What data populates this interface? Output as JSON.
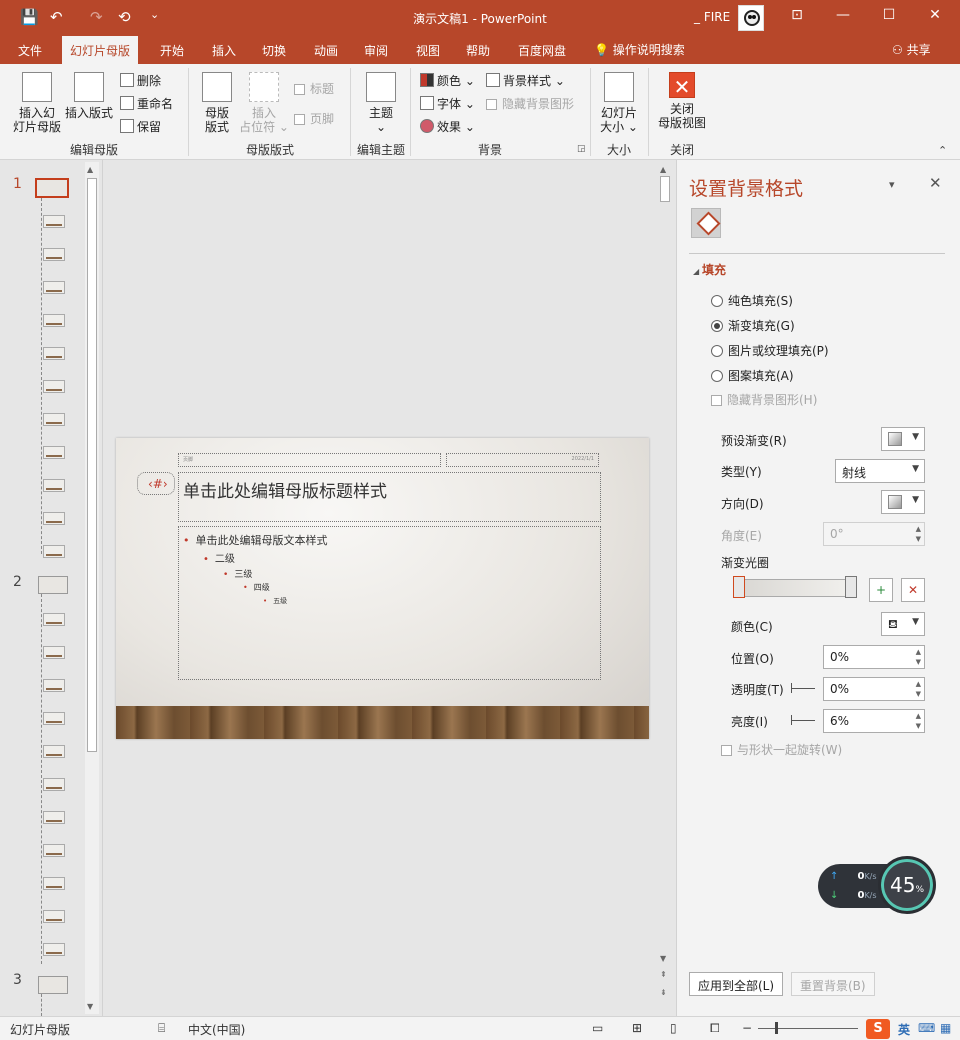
{
  "titlebar": {
    "doc_title": "演示文稿1  -  PowerPoint",
    "user": "_ FIRE",
    "qa_save": "💾",
    "qa_undo": "↶",
    "qa_redo": "↷",
    "qa_present": "⟲",
    "qa_more": "⌄",
    "ribbon_opt": "⊡",
    "minimize": "—",
    "maximize": "☐",
    "close": "✕"
  },
  "tabs": {
    "file": "文件",
    "master": "幻灯片母版",
    "home": "开始",
    "insert": "插入",
    "transitions": "切换",
    "animations": "动画",
    "review": "审阅",
    "view": "视图",
    "help": "帮助",
    "baidu": "百度网盘",
    "tellme": "操作说明搜索",
    "share": "共享"
  },
  "ribbon": {
    "insert_master": "插入幻\n灯片母版",
    "insert_layout": "插入版式",
    "delete": "删除",
    "rename": "重命名",
    "preserve": "保留",
    "group_edit_master": "编辑母版",
    "master_layout": "母版\n版式",
    "insert_placeholder": "插入\n占位符 ⌄",
    "title_chk": "标题",
    "footer_chk": "页脚",
    "group_master_layout": "母版版式",
    "themes": "主题\n⌄",
    "group_edit_theme": "编辑主题",
    "colors": "颜色 ⌄",
    "fonts": "字体 ⌄",
    "effects": "效果 ⌄",
    "bg_styles": "背景样式 ⌄",
    "hide_bg": "隐藏背景图形",
    "group_background": "背景",
    "slide_size": "幻灯片\n大小 ⌄",
    "group_size": "大小",
    "close_master": "关闭\n母版视图",
    "group_close": "关闭"
  },
  "thumbs": {
    "n1": "1",
    "n2": "2",
    "n3": "3"
  },
  "slide": {
    "footer_left": "页脚",
    "footer_right": "2022/1/1",
    "slide_num": "‹#›",
    "title": "单击此处编辑母版标题样式",
    "body": [
      "单击此处编辑母版文本样式",
      "二级",
      "三级",
      "四级",
      "五级"
    ]
  },
  "pane": {
    "title": "设置背景格式",
    "options": "▾",
    "close": "✕",
    "section": "填充",
    "solid": "纯色填充(S)",
    "gradient": "渐变填充(G)",
    "picture": "图片或纹理填充(P)",
    "pattern": "图案填充(A)",
    "hide_bg": "隐藏背景图形(H)",
    "preset": "预设渐变(R)",
    "type": "类型(Y)",
    "type_value": "射线",
    "direction": "方向(D)",
    "angle": "角度(E)",
    "angle_value": "0°",
    "stops": "渐变光圈",
    "color": "颜色(C)",
    "position": "位置(O)",
    "position_value": "0%",
    "transparency": "透明度(T)",
    "transparency_value": "0%",
    "brightness": "亮度(I)",
    "brightness_value": "6%",
    "rotate": "与形状一起旋转(W)",
    "apply_all": "应用到全部(L)",
    "reset": "重置背景(B)"
  },
  "net": {
    "up": "0",
    "down": "0",
    "unit": "K/s",
    "pct": "45",
    "pct_sign": "%"
  },
  "status": {
    "view": "幻灯片母版",
    "lang": "中文(中国)",
    "ime": "英"
  },
  "colors": {
    "accent": "#b7472a"
  }
}
